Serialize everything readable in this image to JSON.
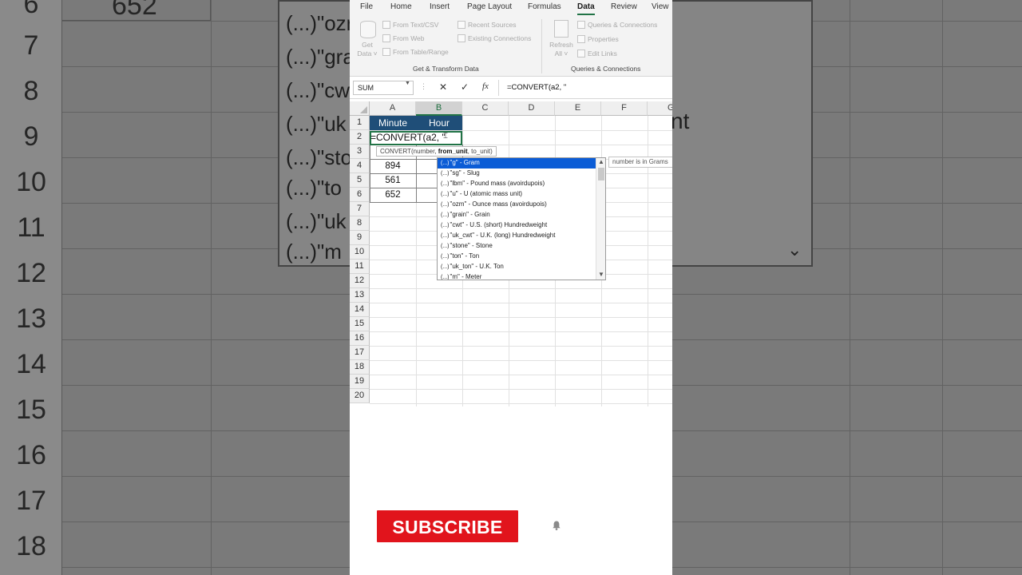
{
  "ribbon": {
    "tabs": [
      "File",
      "Home",
      "Insert",
      "Page Layout",
      "Formulas",
      "Data",
      "Review",
      "View"
    ],
    "active_tab": "Data",
    "get_data": {
      "line1": "Get",
      "line2": "Data ˅"
    },
    "from_text_csv": "From Text/CSV",
    "from_web": "From Web",
    "from_table_range": "From Table/Range",
    "recent_sources": "Recent Sources",
    "existing_connections": "Existing Connections",
    "group_get_transform": "Get & Transform Data",
    "refresh_all": {
      "line1": "Refresh",
      "line2": "All ˅"
    },
    "queries_connections": "Queries & Connections",
    "properties": "Properties",
    "edit_links": "Edit Links",
    "group_queries": "Queries & Connections"
  },
  "formula_bar": {
    "name_box": "SUM",
    "cancel": "✕",
    "enter": "✓",
    "fx": "fx",
    "formula": "=CONVERT(a2, \""
  },
  "grid": {
    "columns": [
      "A",
      "B",
      "C",
      "D",
      "E",
      "F",
      "G"
    ],
    "rows": [
      "1",
      "2",
      "3",
      "4",
      "5",
      "6",
      "7",
      "8",
      "9",
      "10",
      "11",
      "12",
      "13",
      "14",
      "15",
      "16",
      "17",
      "18",
      "19",
      "20"
    ],
    "header_a": "Minute",
    "header_b": "Hour",
    "values_a": [
      "894",
      "561",
      "652"
    ],
    "active_cell_text": "=CONVERT(a2, \""
  },
  "tooltip": {
    "prefix": "CONVERT(number, ",
    "bold": "from_unit",
    "suffix": ", to_unit)"
  },
  "autocomplete": {
    "items": [
      "\"g\" - Gram",
      "\"sg\" - Slug",
      "\"lbm\" - Pound mass (avoirdupois)",
      "\"u\" - U (atomic mass unit)",
      "\"ozm\" - Ounce mass (avoirdupois)",
      "\"grain\" - Grain",
      "\"cwt\" - U.S. (short) Hundredweight",
      "\"uk_cwt\" - U.K. (long) Hundredweight",
      "\"stone\" - Stone",
      "\"ton\" - Ton",
      "\"uk_ton\" - U.K. Ton",
      "\"m\" - Meter"
    ],
    "prefix": "(...)",
    "selected_index": 0,
    "description": "number is in Grams"
  },
  "background": {
    "row_numbers": [
      "6",
      "7",
      "8",
      "9",
      "10",
      "11",
      "12",
      "13",
      "14",
      "15",
      "16",
      "17",
      "18"
    ],
    "top_value": "652",
    "items": [
      "(...)\"ozr",
      "(...)\"gra",
      "(...)\"cw",
      "(...)\"uk",
      "(...)\"sto",
      "(...)\"to",
      "(...)\"uk",
      "(...)\"m"
    ],
    "right_char": "nt"
  },
  "overlay": {
    "subscribe": "SUBSCRIBE"
  },
  "colors": {
    "header_fill": "#1f4e78",
    "excel_green": "#217346",
    "selection_blue": "#0b5cd6",
    "subscribe_red": "#e1141c"
  }
}
